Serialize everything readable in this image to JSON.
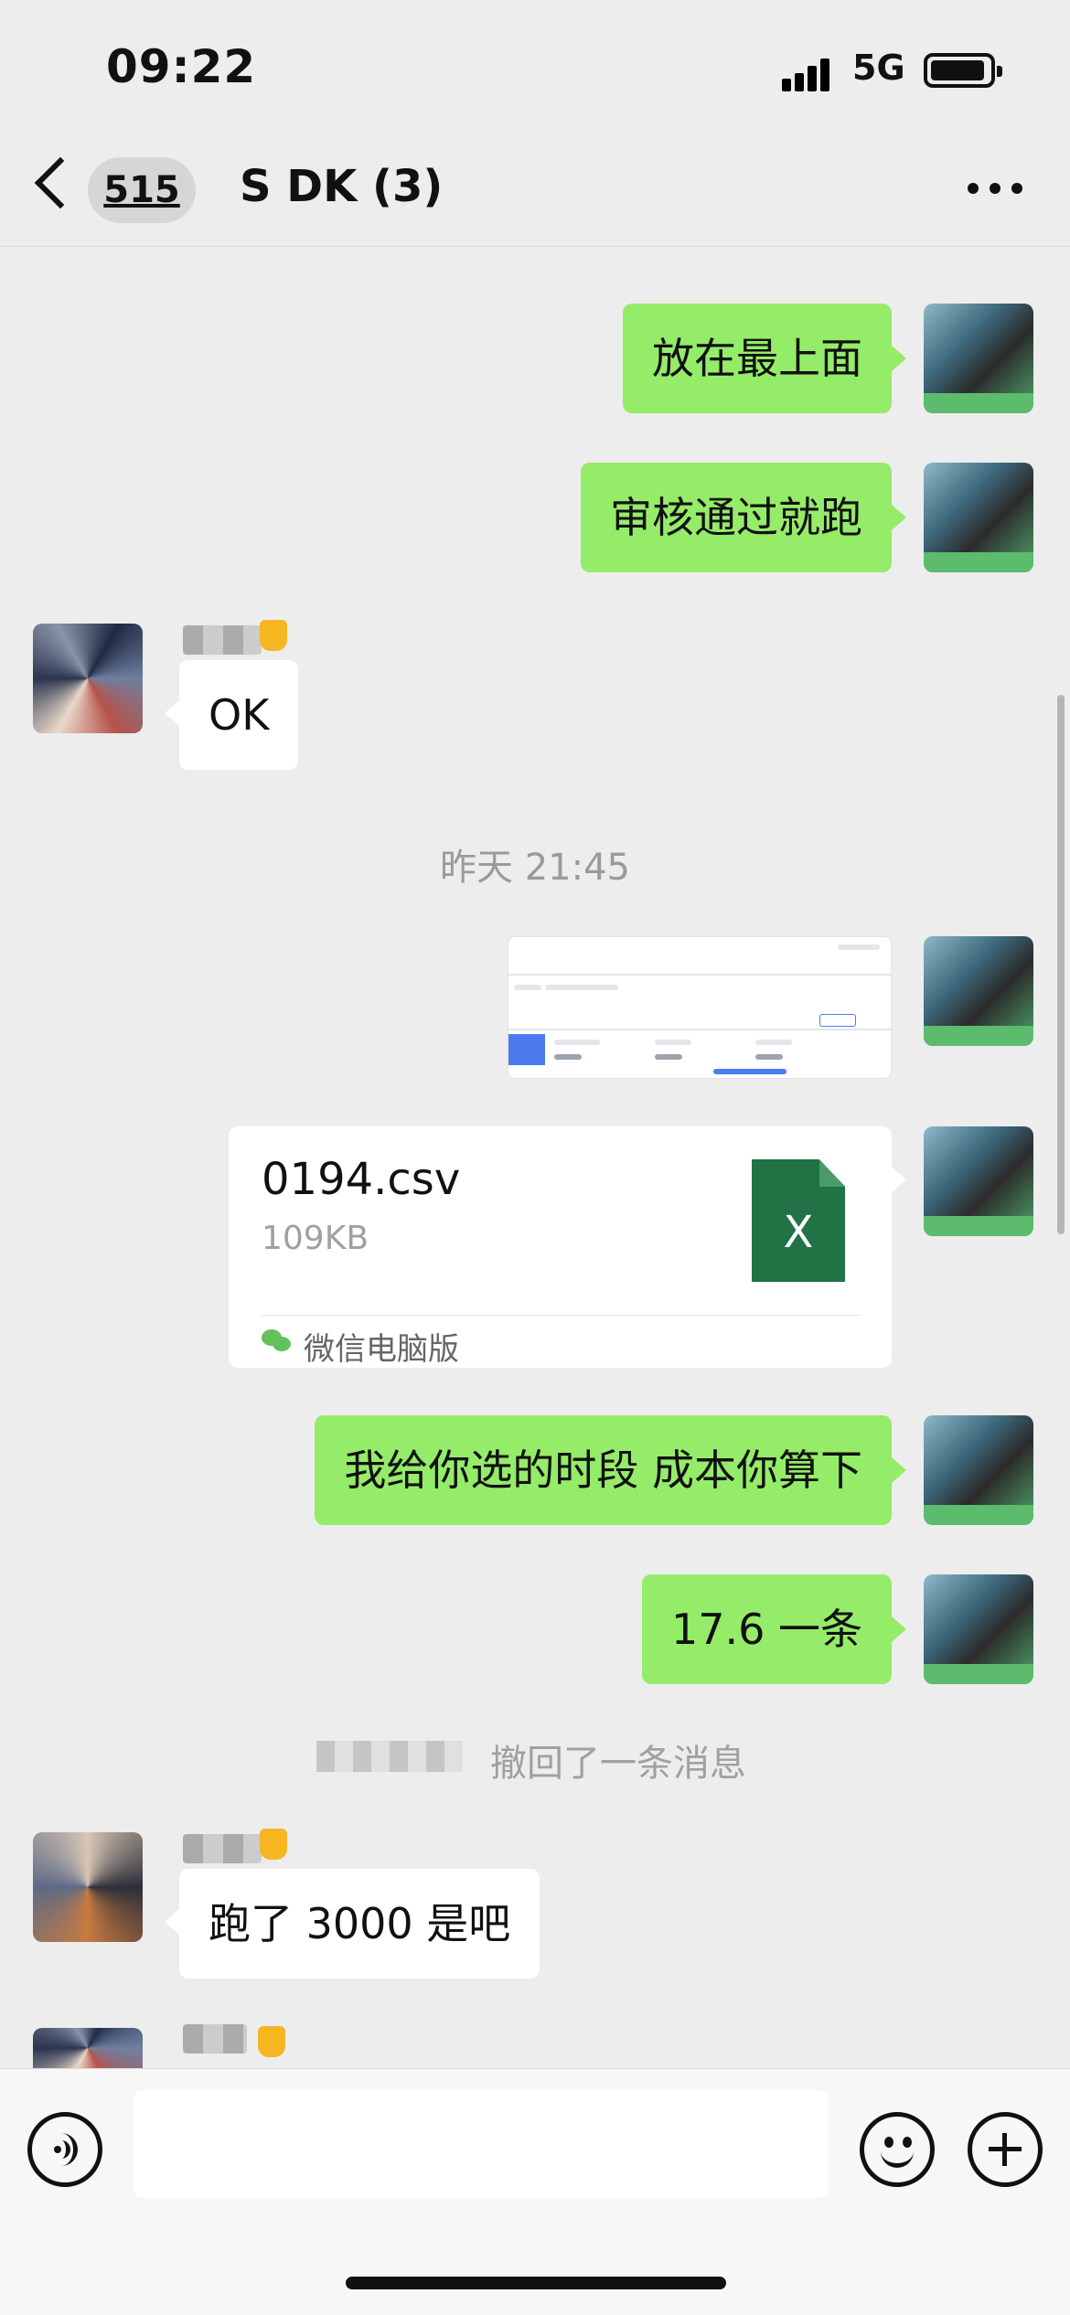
{
  "status_bar": {
    "time": "09:22",
    "network": "5G"
  },
  "nav": {
    "back_count": "515",
    "title": "S DK (3)"
  },
  "messages": {
    "m1": "放在最上面",
    "m2": "审核通过就跑",
    "m3": "OK",
    "timestamp": "昨天 21:45",
    "file": {
      "name": "0194.csv",
      "size": "109KB",
      "icon_letter": "X",
      "source": "微信电脑版"
    },
    "m4": "我给你选的时段 成本你算下",
    "m5": "17.6 一条",
    "recall": "撤回了一条消息",
    "m6": "跑了 3000 是吧"
  },
  "input": {
    "placeholder": ""
  },
  "colors": {
    "bubble_me": "#95ec69",
    "bubble_other": "#ffffff",
    "background": "#ededed"
  },
  "icons": [
    "back-chevron-icon",
    "more-icon",
    "excel-icon",
    "wechat-icon",
    "voice-icon",
    "emoji-icon",
    "plus-icon"
  ]
}
